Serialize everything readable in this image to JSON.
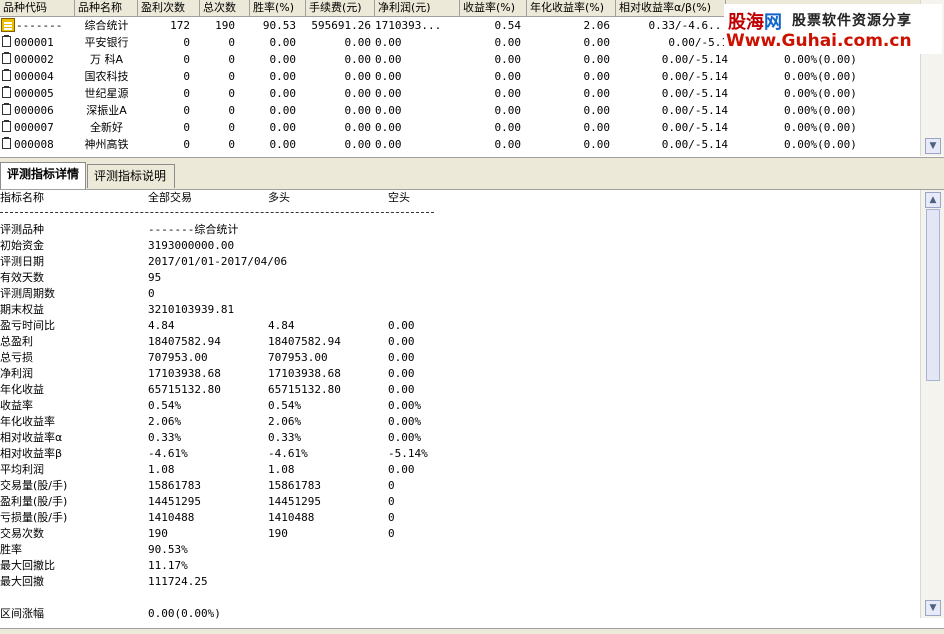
{
  "top_table": {
    "columns": [
      "品种代码",
      "品种名称",
      "盈利次数",
      "总次数",
      "胜率(%)",
      "手续费(元)",
      "净利润(元)",
      "收益率(%)",
      "年化收益率(%)",
      "相对收益率α/β(%)"
    ],
    "rows": [
      {
        "code": "-------",
        "name": "综合统计",
        "wins": "172",
        "total": "190",
        "winrate": "90.53",
        "fee": "595691.26",
        "net": "1710393...",
        "yield": "0.54",
        "annual": "2.06",
        "rel": "0.33/-4.6..."
      },
      {
        "code": "000001",
        "name": "平安银行",
        "wins": "0",
        "total": "0",
        "winrate": "0.00",
        "fee": "0.00",
        "net": "0.00",
        "yield": "0.00",
        "annual": "0.00",
        "rel": "0.00/-5.1"
      },
      {
        "code": "000002",
        "name": "万 科A",
        "wins": "0",
        "total": "0",
        "winrate": "0.00",
        "fee": "0.00",
        "net": "0.00",
        "yield": "0.00",
        "annual": "0.00",
        "rel": "0.00/-5.14",
        "extra": "0.00%(0.00)"
      },
      {
        "code": "000004",
        "name": "国农科技",
        "wins": "0",
        "total": "0",
        "winrate": "0.00",
        "fee": "0.00",
        "net": "0.00",
        "yield": "0.00",
        "annual": "0.00",
        "rel": "0.00/-5.14",
        "extra": "0.00%(0.00)"
      },
      {
        "code": "000005",
        "name": "世纪星源",
        "wins": "0",
        "total": "0",
        "winrate": "0.00",
        "fee": "0.00",
        "net": "0.00",
        "yield": "0.00",
        "annual": "0.00",
        "rel": "0.00/-5.14",
        "extra": "0.00%(0.00)"
      },
      {
        "code": "000006",
        "name": "深振业A",
        "wins": "0",
        "total": "0",
        "winrate": "0.00",
        "fee": "0.00",
        "net": "0.00",
        "yield": "0.00",
        "annual": "0.00",
        "rel": "0.00/-5.14",
        "extra": "0.00%(0.00)"
      },
      {
        "code": "000007",
        "name": "全新好",
        "wins": "0",
        "total": "0",
        "winrate": "0.00",
        "fee": "0.00",
        "net": "0.00",
        "yield": "0.00",
        "annual": "0.00",
        "rel": "0.00/-5.14",
        "extra": "0.00%(0.00)"
      },
      {
        "code": "000008",
        "name": "神州高铁",
        "wins": "0",
        "total": "0",
        "winrate": "0.00",
        "fee": "0.00",
        "net": "0.00",
        "yield": "0.00",
        "annual": "0.00",
        "rel": "0.00/-5.14",
        "extra": "0.00%(0.00)"
      }
    ]
  },
  "watermark": {
    "brand_a": "股海",
    "brand_b": "网",
    "tagline": "股票软件资源分享",
    "url": "Www.Guhai.com.cn"
  },
  "tabs": [
    "评测指标详情",
    "评测指标说明"
  ],
  "detail": {
    "headers": [
      "指标名称",
      "全部交易",
      "多头",
      "空头"
    ],
    "rows": [
      {
        "label": "评测品种",
        "all": "-------综合统计",
        "long": "",
        "short": ""
      },
      {
        "label": "初始资金",
        "all": "3193000000.00",
        "long": "",
        "short": ""
      },
      {
        "label": "评测日期",
        "all": "2017/01/01-2017/04/06",
        "long": "",
        "short": ""
      },
      {
        "label": "有效天数",
        "all": "95",
        "long": "",
        "short": ""
      },
      {
        "label": "评测周期数",
        "all": "0",
        "long": "",
        "short": ""
      },
      {
        "label": "期末权益",
        "all": "3210103939.81",
        "long": "",
        "short": ""
      },
      {
        "label": "盈亏时间比",
        "all": "4.84",
        "long": "4.84",
        "short": "0.00"
      },
      {
        "label": "总盈利",
        "all": "18407582.94",
        "long": "18407582.94",
        "short": "0.00"
      },
      {
        "label": "总亏损",
        "all": "707953.00",
        "long": "707953.00",
        "short": "0.00"
      },
      {
        "label": "净利润",
        "all": "17103938.68",
        "long": "17103938.68",
        "short": "0.00"
      },
      {
        "label": "年化收益",
        "all": "65715132.80",
        "long": "65715132.80",
        "short": "0.00"
      },
      {
        "label": "收益率",
        "all": "0.54%",
        "long": "0.54%",
        "short": "0.00%"
      },
      {
        "label": "年化收益率",
        "all": "2.06%",
        "long": "2.06%",
        "short": "0.00%"
      },
      {
        "label": "相对收益率α",
        "all": "0.33%",
        "long": " 0.33%",
        "short": " 0.00%"
      },
      {
        "label": "相对收益率β",
        "all": "-4.61%",
        "long": " -4.61%",
        "short": " -5.14%"
      },
      {
        "label": "平均利润",
        "all": "1.08",
        "long": "1.08",
        "short": "0.00"
      },
      {
        "label": "交易量(股/手)",
        "all": "15861783",
        "long": "15861783",
        "short": "0"
      },
      {
        "label": "盈利量(股/手)",
        "all": "14451295",
        "long": "14451295",
        "short": "0"
      },
      {
        "label": "亏损量(股/手)",
        "all": "1410488",
        "long": "1410488",
        "short": "0"
      },
      {
        "label": "交易次数",
        "all": "190",
        "long": "190",
        "short": "0"
      },
      {
        "label": "胜率",
        "all": "90.53%",
        "long": "",
        "short": ""
      },
      {
        "label": "最大回撤比",
        "all": "11.17%",
        "long": "",
        "short": ""
      },
      {
        "label": "最大回撤",
        "all": "111724.25",
        "long": "",
        "short": ""
      },
      {
        "label": "",
        "all": "",
        "long": "",
        "short": ""
      },
      {
        "label": "区间涨幅",
        "all": "0.00(0.00%)",
        "long": "",
        "short": ""
      }
    ]
  }
}
